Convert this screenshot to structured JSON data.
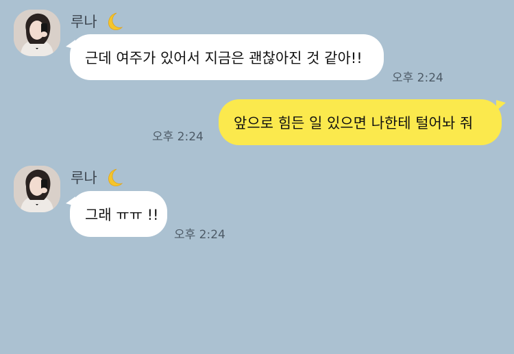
{
  "messages": [
    {
      "side": "in",
      "sender": "루나",
      "text": "근데 여주가 있어서 지금은 괜찮아진 것 같아!!",
      "time": "오후 2:24"
    },
    {
      "side": "out",
      "text": "앞으로 힘든 일 있으면 나한테 털어놔 줘",
      "time": "오후 2:24"
    },
    {
      "side": "in",
      "sender": "루나",
      "text": "그래 ㅠㅠ !!",
      "time": "오후 2:24"
    }
  ],
  "icons": {
    "sender_badge": "crescent-moon-icon",
    "avatar": "profile-photo"
  },
  "colors": {
    "background": "#abc1d1",
    "incoming_bubble": "#ffffff",
    "outgoing_bubble": "#fbe94d"
  }
}
